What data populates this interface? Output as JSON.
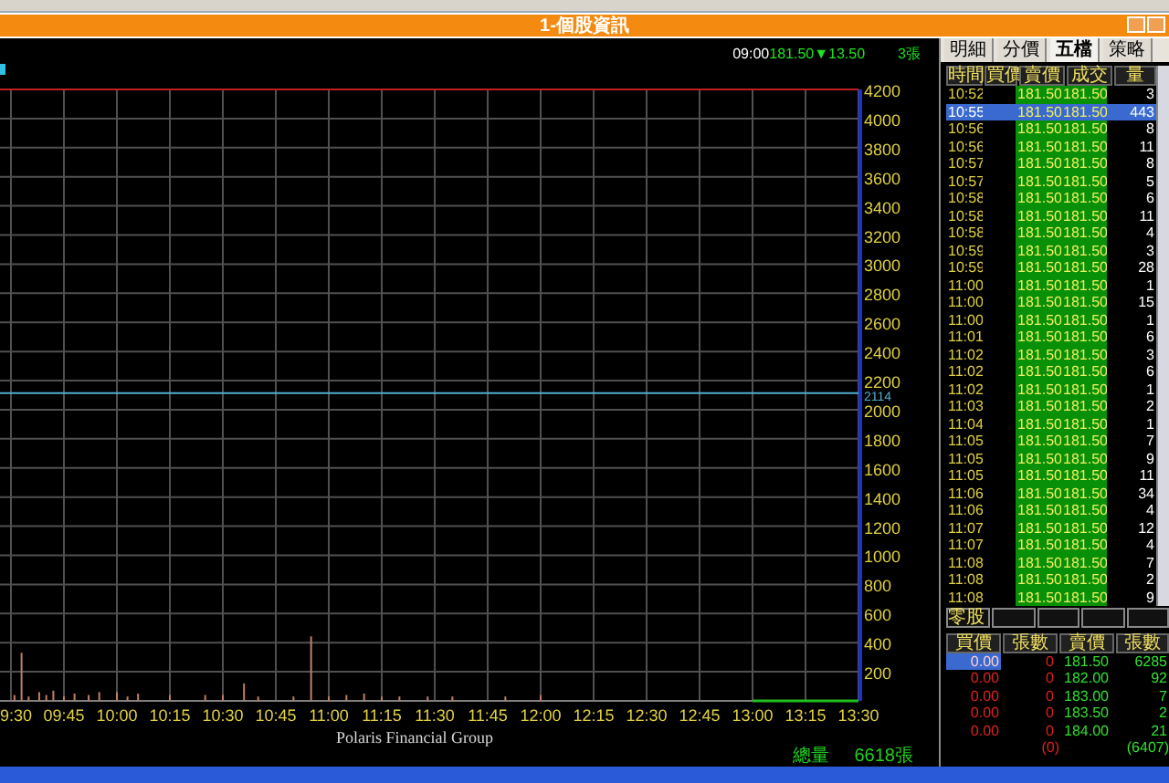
{
  "window": {
    "title": "1-個股資訊"
  },
  "quote_header": {
    "time": "09:00",
    "price": "181.50",
    "change": "▼13.50",
    "volume": "3張"
  },
  "chart": {
    "y_axis_labels": [
      "4200",
      "4000",
      "3800",
      "3600",
      "3400",
      "3200",
      "3000",
      "2800",
      "2600",
      "2400",
      "2200",
      "2000",
      "1800",
      "1600",
      "1400",
      "1200",
      "1000",
      "800",
      "600",
      "400",
      "200"
    ],
    "x_axis_labels": [
      "9:30",
      "09:45",
      "10:00",
      "10:15",
      "10:30",
      "10:45",
      "11:00",
      "11:15",
      "11:30",
      "11:45",
      "12:00",
      "12:15",
      "12:30",
      "12:45",
      "13:00",
      "13:15",
      "13:30"
    ],
    "reference_label": "2114",
    "footer": "Polaris Financial Group",
    "total_label": "總量",
    "total_value": "6618張"
  },
  "tabs": [
    {
      "label": "明細",
      "selected": false
    },
    {
      "label": "分價",
      "selected": false
    },
    {
      "label": "五檔",
      "selected": true
    },
    {
      "label": "策略",
      "selected": false
    }
  ],
  "ticks_table": {
    "columns": [
      "時間",
      "買價",
      "賣價",
      "成交",
      "量"
    ],
    "rows": [
      {
        "time": "10:52",
        "ask": "181.50",
        "trade": "181.50",
        "volume": "3",
        "selected": false
      },
      {
        "time": "10:55",
        "ask": "181.50",
        "trade": "181.50",
        "volume": "443",
        "selected": true
      },
      {
        "time": "10:56",
        "ask": "181.50",
        "trade": "181.50",
        "volume": "8",
        "selected": false
      },
      {
        "time": "10:56",
        "ask": "181.50",
        "trade": "181.50",
        "volume": "11",
        "selected": false
      },
      {
        "time": "10:57",
        "ask": "181.50",
        "trade": "181.50",
        "volume": "8",
        "selected": false
      },
      {
        "time": "10:57",
        "ask": "181.50",
        "trade": "181.50",
        "volume": "5",
        "selected": false
      },
      {
        "time": "10:58",
        "ask": "181.50",
        "trade": "181.50",
        "volume": "6",
        "selected": false
      },
      {
        "time": "10:58",
        "ask": "181.50",
        "trade": "181.50",
        "volume": "11",
        "selected": false
      },
      {
        "time": "10:58",
        "ask": "181.50",
        "trade": "181.50",
        "volume": "4",
        "selected": false
      },
      {
        "time": "10:59",
        "ask": "181.50",
        "trade": "181.50",
        "volume": "3",
        "selected": false
      },
      {
        "time": "10:59",
        "ask": "181.50",
        "trade": "181.50",
        "volume": "28",
        "selected": false
      },
      {
        "time": "11:00",
        "ask": "181.50",
        "trade": "181.50",
        "volume": "1",
        "selected": false
      },
      {
        "time": "11:00",
        "ask": "181.50",
        "trade": "181.50",
        "volume": "15",
        "selected": false
      },
      {
        "time": "11:00",
        "ask": "181.50",
        "trade": "181.50",
        "volume": "1",
        "selected": false
      },
      {
        "time": "11:01",
        "ask": "181.50",
        "trade": "181.50",
        "volume": "6",
        "selected": false
      },
      {
        "time": "11:02",
        "ask": "181.50",
        "trade": "181.50",
        "volume": "3",
        "selected": false
      },
      {
        "time": "11:02",
        "ask": "181.50",
        "trade": "181.50",
        "volume": "6",
        "selected": false
      },
      {
        "time": "11:02",
        "ask": "181.50",
        "trade": "181.50",
        "volume": "1",
        "selected": false
      },
      {
        "time": "11:03",
        "ask": "181.50",
        "trade": "181.50",
        "volume": "2",
        "selected": false
      },
      {
        "time": "11:04",
        "ask": "181.50",
        "trade": "181.50",
        "volume": "1",
        "selected": false
      },
      {
        "time": "11:05",
        "ask": "181.50",
        "trade": "181.50",
        "volume": "7",
        "selected": false
      },
      {
        "time": "11:05",
        "ask": "181.50",
        "trade": "181.50",
        "volume": "9",
        "selected": false
      },
      {
        "time": "11:05",
        "ask": "181.50",
        "trade": "181.50",
        "volume": "11",
        "selected": false
      },
      {
        "time": "11:06",
        "ask": "181.50",
        "trade": "181.50",
        "volume": "34",
        "selected": false
      },
      {
        "time": "11:06",
        "ask": "181.50",
        "trade": "181.50",
        "volume": "4",
        "selected": false
      },
      {
        "time": "11:07",
        "ask": "181.50",
        "trade": "181.50",
        "volume": "12",
        "selected": false
      },
      {
        "time": "11:07",
        "ask": "181.50",
        "trade": "181.50",
        "volume": "4",
        "selected": false
      },
      {
        "time": "11:08",
        "ask": "181.50",
        "trade": "181.50",
        "volume": "7",
        "selected": false
      },
      {
        "time": "11:08",
        "ask": "181.50",
        "trade": "181.50",
        "volume": "2",
        "selected": false
      },
      {
        "time": "11:08",
        "ask": "181.50",
        "trade": "181.50",
        "volume": "9",
        "selected": false
      }
    ]
  },
  "odd_lot": {
    "label": "零股"
  },
  "order_book": {
    "columns": [
      "買價",
      "張數",
      "賣價",
      "張數"
    ],
    "rows": [
      {
        "bid": "0.00",
        "bid_qty": "0",
        "ask": "181.50",
        "ask_qty": "6285",
        "selected": true
      },
      {
        "bid": "0.00",
        "bid_qty": "0",
        "ask": "182.00",
        "ask_qty": "92",
        "selected": false
      },
      {
        "bid": "0.00",
        "bid_qty": "0",
        "ask": "183.00",
        "ask_qty": "7",
        "selected": false
      },
      {
        "bid": "0.00",
        "bid_qty": "0",
        "ask": "183.50",
        "ask_qty": "2",
        "selected": false
      },
      {
        "bid": "0.00",
        "bid_qty": "0",
        "ask": "184.00",
        "ask_qty": "21",
        "selected": false
      }
    ],
    "bid_total": "(0)",
    "ask_total": "(6407)"
  }
}
